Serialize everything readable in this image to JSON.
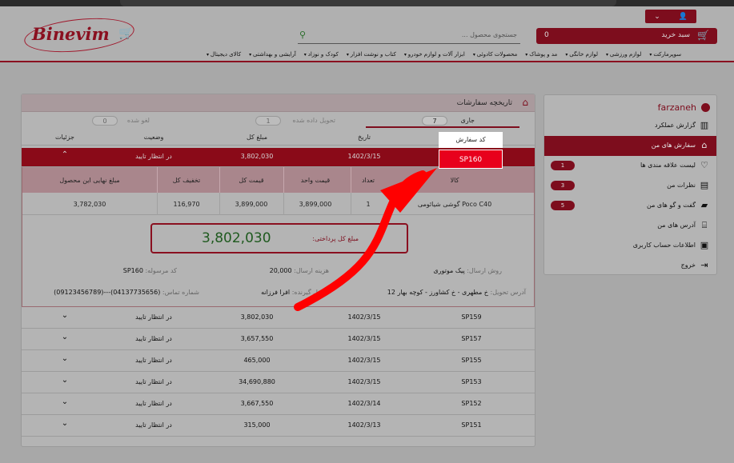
{
  "header": {
    "logo_text": "Binevim",
    "search_placeholder": "جستجوی محصول ...",
    "cart_label": "سبد خرید",
    "cart_count": "0",
    "categories": [
      "کالای دیجیتال",
      "آرایشی و بهداشتی",
      "کودک و نوزاد",
      "کتاب و نوشت افزار",
      "ابزار آلات و لوازم خودرو",
      "محصولات کادوئی",
      "مد و پوشاک",
      "لوازم خانگی",
      "لوازم ورزشی",
      "سوپرمارکت"
    ]
  },
  "sidebar": {
    "username": "farzaneh",
    "items": [
      {
        "label": "گزارش عملکرد",
        "icon": "chart-icon",
        "badge": ""
      },
      {
        "label": "سفارش های من",
        "icon": "basket-icon",
        "badge": ""
      },
      {
        "label": "لیست علاقه مندی ها",
        "icon": "heart-icon",
        "badge": "1"
      },
      {
        "label": "نظرات من",
        "icon": "comment-icon",
        "badge": "3"
      },
      {
        "label": "گفت و گو های من",
        "icon": "chat-icon",
        "badge": "5"
      },
      {
        "label": "آدرس های من",
        "icon": "bank-icon",
        "badge": ""
      },
      {
        "label": "اطلاعات حساب کاربری",
        "icon": "contact-icon",
        "badge": ""
      },
      {
        "label": "خروج",
        "icon": "logout-icon",
        "badge": ""
      }
    ]
  },
  "orders": {
    "title": "تاریخچه سفارشات",
    "tabs": [
      {
        "label": "جاری",
        "count": "7"
      },
      {
        "label": "تحویل داده شده",
        "count": "1"
      },
      {
        "label": "لغو شده",
        "count": "0"
      }
    ],
    "columns": [
      "کد سفارش",
      "تاریخ",
      "مبلغ کل",
      "وضعیت",
      "جزئیات"
    ],
    "selected": {
      "code": "SP160",
      "date": "1402/3/15",
      "amount": "3,802,030",
      "status": "در انتظار تایید"
    },
    "detail": {
      "item_columns": [
        "کالا",
        "تعداد",
        "قیمت واحد",
        "قیمت کل",
        "تخفیف کل",
        "مبلغ نهایی این محصول"
      ],
      "item": {
        "name": "گوشی شیائومی Poco C40",
        "qty": "1",
        "unit_price": "3,899,000",
        "total": "3,899,000",
        "discount": "116,970",
        "final": "3,782,030"
      },
      "payable_label": "مبلغ کل پرداختی:",
      "payable_value": "3,802,030",
      "shipping_method_label": "روش ارسال:",
      "shipping_method": "پیک موتوری",
      "shipping_cost_label": "هزینه ارسال:",
      "shipping_cost": "20,000",
      "parcel_code_label": "کد مرسوله:",
      "parcel_code": "SP160",
      "address_label": "آدرس تحویل:",
      "address": "خ مطهری - خ کشاورز - کوچه بهار 12",
      "receiver_label": "تحویل گیرنده:",
      "receiver": "افرا فرزانه",
      "phone_label": "شماره تماس:",
      "phone": "(04137735656)---(09123456789)"
    },
    "rows": [
      {
        "code": "SP159",
        "date": "1402/3/15",
        "amount": "3,802,030",
        "status": "در انتظار تایید"
      },
      {
        "code": "SP157",
        "date": "1402/3/15",
        "amount": "3,657,550",
        "status": "در انتظار تایید"
      },
      {
        "code": "SP155",
        "date": "1402/3/15",
        "amount": "465,000",
        "status": "در انتظار تایید"
      },
      {
        "code": "SP153",
        "date": "1402/3/15",
        "amount": "34,690,880",
        "status": "در انتظار تایید"
      },
      {
        "code": "SP152",
        "date": "1402/3/14",
        "amount": "3,667,550",
        "status": "در انتظار تایید"
      },
      {
        "code": "SP151",
        "date": "1402/3/13",
        "amount": "315,000",
        "status": "در انتظار تایید"
      }
    ]
  },
  "colors": {
    "brand": "#7d0d1d",
    "highlight": "#e8001c",
    "arrow": "#ff0000",
    "total_green": "#1f5a1f"
  }
}
